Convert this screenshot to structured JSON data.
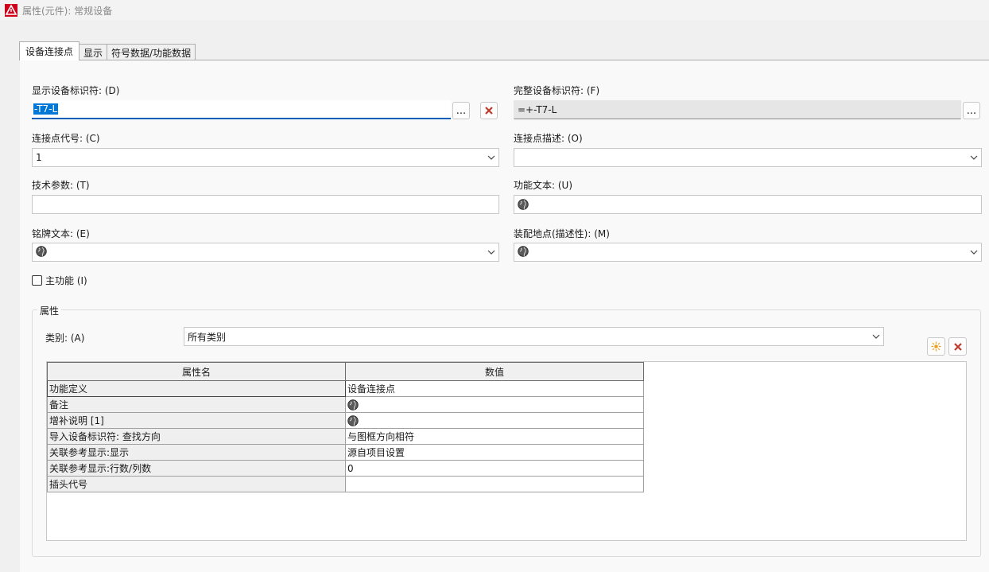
{
  "window": {
    "title": "属性(元件): 常规设备"
  },
  "tabs": [
    {
      "label": "设备连接点",
      "active": true
    },
    {
      "label": "显示",
      "active": false
    },
    {
      "label": "符号数据/功能数据",
      "active": false
    }
  ],
  "form": {
    "display_id_label": "显示设备标识符: (D)",
    "display_id_value": "-T7-L",
    "full_id_label": "完整设备标识符: (F)",
    "full_id_value": "=+-T7-L",
    "conn_code_label": "连接点代号: (C)",
    "conn_code_value": "1",
    "conn_desc_label": "连接点描述: (O)",
    "conn_desc_value": "",
    "tech_param_label": "技术参数: (T)",
    "tech_param_value": "",
    "func_text_label": "功能文本: (U)",
    "nameplate_label": "铭牌文本: (E)",
    "mount_loc_label": "装配地点(描述性): (M)",
    "main_function_label": "主功能 (I)",
    "main_function_checked": false,
    "more_button": "..."
  },
  "properties": {
    "group_title": "属性",
    "category_label": "类别: (A)",
    "category_value": "所有类别",
    "columns": [
      "属性名",
      "数值"
    ],
    "rows": [
      {
        "name": "功能定义",
        "value": "设备连接点",
        "globe": false
      },
      {
        "name": "备注",
        "value": "",
        "globe": true
      },
      {
        "name": "增补说明 [1]",
        "value": "",
        "globe": true
      },
      {
        "name": "导入设备标识符: 查找方向",
        "value": "与图框方向相符",
        "globe": false
      },
      {
        "name": "关联参考显示:显示",
        "value": "源自项目设置",
        "globe": false
      },
      {
        "name": "关联参考显示:行数/列数",
        "value": "0",
        "globe": false
      },
      {
        "name": "插头代号",
        "value": "",
        "globe": false
      }
    ]
  },
  "colors": {
    "accent": "#005fb8",
    "selection": "#0078d7",
    "delete": "#c0392b"
  }
}
